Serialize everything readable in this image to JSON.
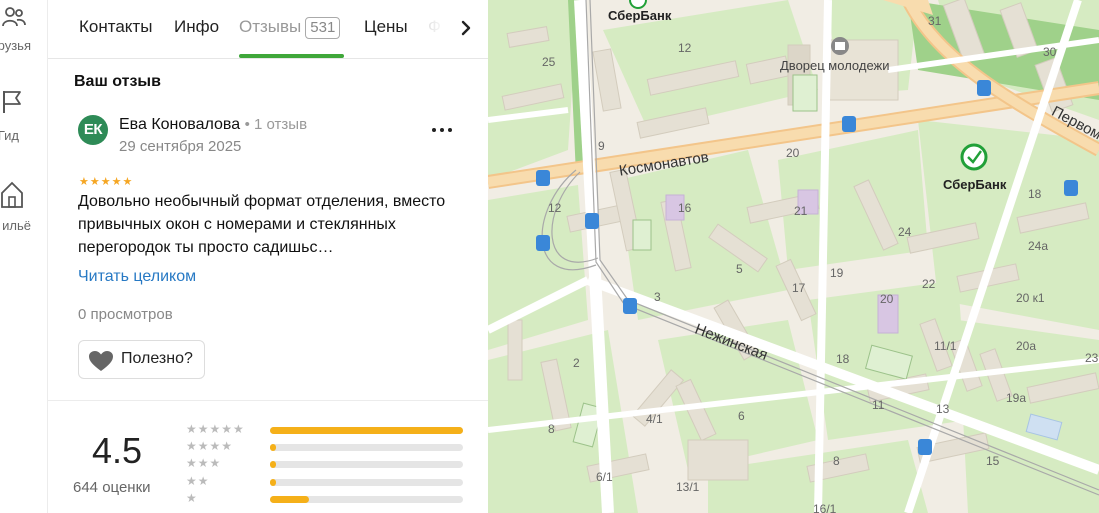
{
  "rail": {
    "items": [
      {
        "label": "рузья",
        "icon": "friends-icon"
      },
      {
        "label": "Гид",
        "icon": "guide-flag-icon"
      },
      {
        "label": "ильё",
        "icon": "housing-icon"
      }
    ]
  },
  "tabs": [
    {
      "label": "Контакты"
    },
    {
      "label": "Инфо"
    },
    {
      "label": "Отзывы",
      "count": "531",
      "active": true
    },
    {
      "label": "Цены"
    },
    {
      "label": "Ф"
    }
  ],
  "review": {
    "section_title": "Ваш отзыв",
    "avatar_initials": "ЕК",
    "author": "Ева Коновалова",
    "author_reviews": "1 отзыв",
    "date": "29 сентября 2025",
    "stars": 5,
    "text": "Довольно необычный формат отделения, вместо привычных окон с номерами и стеклянных перегородок ты просто садишьс…",
    "read_more": "Читать целиком",
    "views": "0 просмотров",
    "useful_label": "Полезно?"
  },
  "summary": {
    "rating": "4.5",
    "count_label": "644 оценки",
    "distribution": [
      {
        "stars": 5,
        "fraction": 1.0
      },
      {
        "stars": 4,
        "fraction": 0.03
      },
      {
        "stars": 3,
        "fraction": 0.03
      },
      {
        "stars": 2,
        "fraction": 0.03
      },
      {
        "stars": 1,
        "fraction": 0.2
      }
    ]
  },
  "map": {
    "streets": [
      "Космонавтов",
      "Нежинская",
      "Первом"
    ],
    "pois": [
      "СберБанк",
      "СберБанк",
      "Дворец молодежи"
    ],
    "house_numbers": [
      "25",
      "12",
      "9",
      "20",
      "31",
      "30",
      "18",
      "12",
      "16",
      "21",
      "24",
      "24a",
      "5",
      "19",
      "3",
      "17",
      "22",
      "20 к1",
      "2",
      "18",
      "20",
      "11/1",
      "20a",
      "19a",
      "23",
      "6",
      "4/1",
      "11",
      "13",
      "8",
      "15",
      "6/1",
      "13/1",
      "8",
      "16/1"
    ]
  },
  "colors": {
    "accent": "#3fa73a",
    "link": "#2779c4",
    "star": "#f5a623",
    "bar": "#f5b019",
    "avatar": "#2e8b57"
  }
}
